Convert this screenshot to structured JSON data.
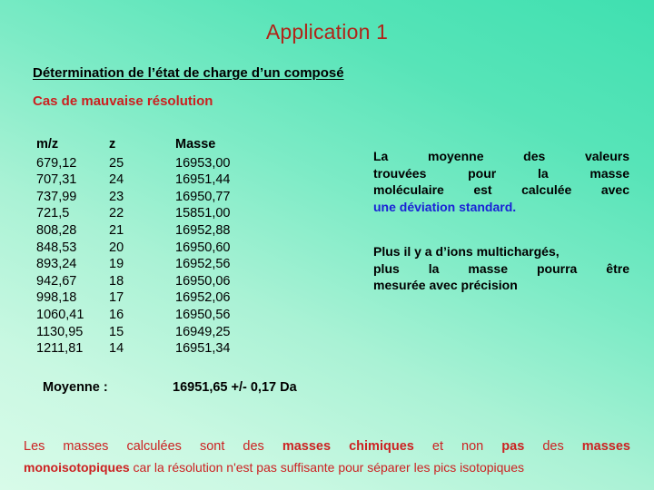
{
  "slide": {
    "title": "Application 1",
    "subject_heading": "Détermination de l’état de charge d’un composé",
    "case_heading": "Cas de mauvaise résolution"
  },
  "colors": {
    "title": "#b02418",
    "case_heading": "#cc1f1f",
    "highlight": "#1a21d6",
    "footer": "#cc2222",
    "background_light": "#d8fbe9",
    "background_dark": "#3fe0b0"
  },
  "table": {
    "headers": [
      "m/z",
      "z",
      "Masse"
    ],
    "rows": [
      [
        "679,12",
        "25",
        "16953,00"
      ],
      [
        "707,31",
        "24",
        "16951,44"
      ],
      [
        "737,99",
        "23",
        "16950,77"
      ],
      [
        "721,5",
        "22",
        "15851,00"
      ],
      [
        "808,28",
        "21",
        "16952,88"
      ],
      [
        "848,53",
        "20",
        "16950,60"
      ],
      [
        "893,24",
        "19",
        "16952,56"
      ],
      [
        "942,67",
        "18",
        "16950,06"
      ],
      [
        "998,18",
        "17",
        "16952,06"
      ],
      [
        "1060,41",
        "16",
        "16950,56"
      ],
      [
        "1130,95",
        "15",
        "16949,25"
      ],
      [
        "1211,81",
        "14",
        "16951,34"
      ]
    ],
    "average_label": "Moyenne :",
    "average_value": "16951,65  +/- 0,17 Da"
  },
  "notes": {
    "average": {
      "line1": "La moyenne des valeurs",
      "line2": "trouvées pour la masse",
      "line3": "moléculaire est calculée avec",
      "highlight": "une déviation standard."
    },
    "charge": {
      "line1": "Plus il y a d’ions multichargés,",
      "line2": "plus la masse pourra être",
      "line3": "mesurée avec précision"
    }
  },
  "footer": {
    "l1_a": "Les masses calculées sont des ",
    "l1_b": "masses chimiques",
    "l1_c": " et non ",
    "l1_d": "pas",
    "l1_e": " des ",
    "l1_f": "masses",
    "l2_a": "monoisotopiques",
    "l2_b": " car la résolution n'est pas suffisante pour séparer les pics isotopiques"
  }
}
